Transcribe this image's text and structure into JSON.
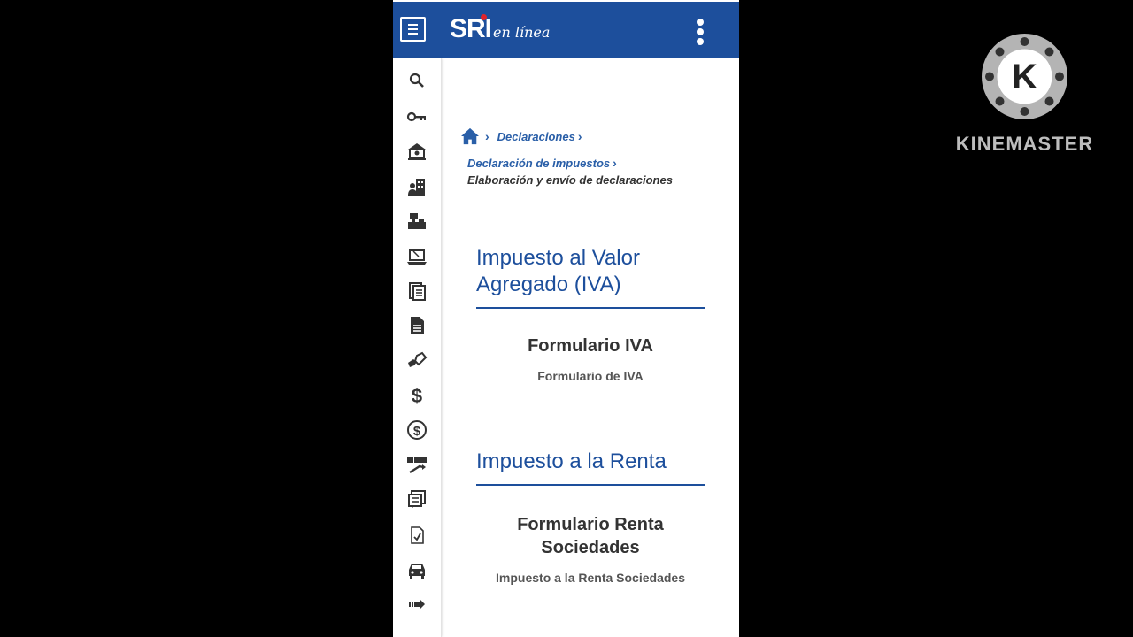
{
  "header": {
    "logo_main": "SRI",
    "logo_sub": "en línea",
    "menu_icon": "hamburger-icon",
    "more_icon": "kebab-icon",
    "color": "#1d4f9c"
  },
  "sidebar": {
    "icons": [
      "search-icon",
      "key-icon",
      "building-icon",
      "person-building-icon",
      "cash-register-icon",
      "laptop-icon",
      "documents-icon",
      "file-text-icon",
      "hand-tag-icon",
      "dollar-icon",
      "dollar-circle-icon",
      "exchange-icon",
      "forms-icon",
      "checklist-icon",
      "car-icon",
      "arrow-right-icon"
    ]
  },
  "breadcrumb": {
    "level1": "Declaraciones",
    "level2": "Declaración de impuestos",
    "current": "Elaboración y envío de declaraciones"
  },
  "sections": [
    {
      "title": "Impuesto al Valor Agregado (IVA)",
      "card_title": "Formulario IVA",
      "card_sub": "Formulario de IVA"
    },
    {
      "title": "Impuesto a la Renta",
      "card_title": "Formulario Renta Sociedades",
      "card_sub": "Impuesto a la Renta Sociedades"
    }
  ],
  "watermark": {
    "text": "KINEMASTER",
    "letter": "K"
  }
}
